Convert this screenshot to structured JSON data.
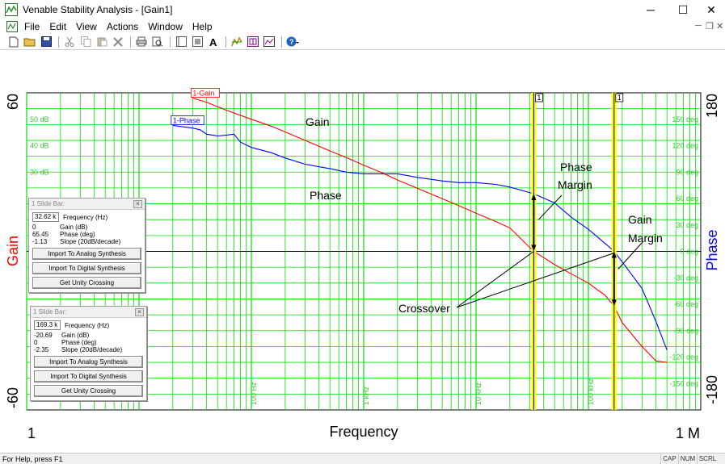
{
  "window": {
    "title": "Venable Stability Analysis - [Gain1]",
    "minimize": "─",
    "maximize": "☐",
    "close": "✕"
  },
  "menu": {
    "items": [
      "File",
      "Edit",
      "View",
      "Actions",
      "Window",
      "Help"
    ],
    "mdi_min": "─",
    "mdi_restore": "❐",
    "mdi_close": "✕"
  },
  "toolbar": {
    "icons": [
      "new-icon",
      "open-icon",
      "save-icon",
      "cut-icon",
      "copy-icon",
      "paste-icon",
      "delete-icon",
      "print-icon",
      "print-preview-icon",
      "layout-icon",
      "frame-icon",
      "font-icon",
      "sweep-icon",
      "synthesis-icon",
      "graph-icon",
      "help-icon"
    ]
  },
  "chart_data": {
    "type": "line",
    "title": "",
    "xlabel": "Frequency",
    "x_scale": "log",
    "xlim": [
      1,
      1000000
    ],
    "x_end_labels": [
      "1",
      "1 M"
    ],
    "x_decade_labels": [
      "100 Hz",
      "1 kHz",
      "10 kHz",
      "100 kHz"
    ],
    "y_left_label": "Gain",
    "y_left_lim": [
      -60,
      60
    ],
    "y_left_end_labels": [
      "60",
      "-60"
    ],
    "y_left_ticks": [
      "50 dB",
      "40 dB",
      "30 dB"
    ],
    "y_right_label": "Phase",
    "y_right_lim": [
      -180,
      180
    ],
    "y_right_end_labels": [
      "180",
      "-180"
    ],
    "y_right_ticks": [
      "150 deg",
      "120 deg",
      "90 deg",
      "60 deg",
      "30 deg",
      "0 deg",
      "-30 deg",
      "-60 deg",
      "-90 deg",
      "-120 deg",
      "-150 deg"
    ],
    "series": [
      {
        "name": "1-Gain",
        "axis": "left",
        "color": "#ff0000",
        "x": [
          30,
          40,
          60,
          100,
          150,
          200,
          300,
          500,
          700,
          1000,
          1500,
          2000,
          3000,
          5000,
          7000,
          10000,
          15000,
          20000,
          32620,
          50000,
          70000,
          100000,
          120000,
          140000,
          169300,
          200000,
          300000,
          400000,
          500000
        ],
        "y": [
          58.0,
          56.4,
          53.4,
          50.0,
          47.4,
          45.2,
          42.0,
          38.0,
          35.5,
          32.6,
          29.5,
          27.0,
          23.9,
          19.9,
          17.3,
          14.4,
          11.3,
          8.9,
          0.0,
          -5.0,
          -8.5,
          -12.0,
          -14.5,
          -16.5,
          -20.7,
          -27.0,
          -36.0,
          -41.5,
          -42.0
        ]
      },
      {
        "name": "1-Phase",
        "axis": "right",
        "color": "#0000ff",
        "x": [
          20,
          30,
          35,
          40,
          45,
          50,
          60,
          70,
          80,
          100,
          150,
          200,
          300,
          400,
          500,
          700,
          1000,
          2000,
          3000,
          5000,
          7000,
          10000,
          15000,
          20000,
          32620,
          50000,
          70000,
          100000,
          150000,
          169300,
          200000,
          300000,
          400000,
          500000
        ],
        "y": [
          143,
          140,
          138,
          133,
          132,
          131,
          132,
          133,
          124,
          118,
          112,
          106,
          99,
          96,
          94,
          90,
          88,
          88,
          84,
          80,
          78,
          78,
          76,
          73,
          65.45,
          55,
          39,
          25,
          6,
          0,
          -12,
          -42,
          -80,
          -112
        ]
      }
    ],
    "markers": [
      {
        "label": "1",
        "x": 32620
      },
      {
        "label": "1",
        "x": 169300
      }
    ],
    "annotations": {
      "gain": "Gain",
      "phase": "Phase",
      "phase_margin": [
        "Phase",
        "Margin"
      ],
      "gain_margin": [
        "Gain",
        "Margin"
      ],
      "crossover": "Crossover"
    }
  },
  "slidebars": [
    {
      "title": "1  Slide Bar:",
      "frequency": "32.62 k",
      "frequency_label": "Frequency (Hz)",
      "rows": [
        {
          "value": "0",
          "label": "Gain (dB)"
        },
        {
          "value": "65.45",
          "label": "Phase (deg)"
        },
        {
          "value": "-1.13",
          "label": "Slope (20dB/decade)"
        }
      ],
      "buttons": [
        "Import To Analog Synthesis",
        "Import To Digital Synthesis",
        "Get Unity Crossing"
      ]
    },
    {
      "title": "1  Slide Bar:",
      "frequency": "169.3 k",
      "frequency_label": "Frequency (Hz)",
      "rows": [
        {
          "value": "-20.69",
          "label": "Gain (dB)"
        },
        {
          "value": "0",
          "label": "Phase (deg)"
        },
        {
          "value": "-2.35",
          "label": "Slope (20dB/decade)"
        }
      ],
      "buttons": [
        "Import To Analog Synthesis",
        "Import To Digital Synthesis",
        "Get Unity Crossing"
      ]
    }
  ],
  "statusbar": {
    "text": "For Help, press F1",
    "indicators": [
      "CAP",
      "NUM",
      "SCRL"
    ]
  },
  "colors": {
    "grid": "#00e000",
    "gain_axis": "#ff0000",
    "phase_axis": "#0000ff",
    "marker": "#ffff00",
    "tick_text": "#33cc33"
  }
}
